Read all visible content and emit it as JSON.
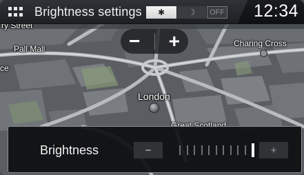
{
  "header": {
    "menu_icon": "grid-menu-icon",
    "title": "Brightness settings",
    "modes": {
      "day_icon": "sun-icon",
      "night_icon": "moon-icon",
      "off_label": "OFF",
      "selected": "day"
    },
    "clock": "12:34"
  },
  "map": {
    "labels": {
      "pall_mall": "Pall Mall",
      "charing_cross": "Charing Cross",
      "london": "London",
      "great_scotland": "Great Scotland",
      "top_left_street": "ry Street",
      "left_edge": "ce"
    },
    "zoom": {
      "out_label": "−",
      "in_label": "+"
    }
  },
  "brightness": {
    "label": "Brightness",
    "minus_label": "−",
    "plus_label": "+",
    "steps": 11,
    "level": 11
  },
  "colors": {
    "header_bg": "#1e2023",
    "panel_bg": "#0e0f10",
    "selected_mode_bg": "#e6e6e6",
    "map_base": "#505459"
  }
}
